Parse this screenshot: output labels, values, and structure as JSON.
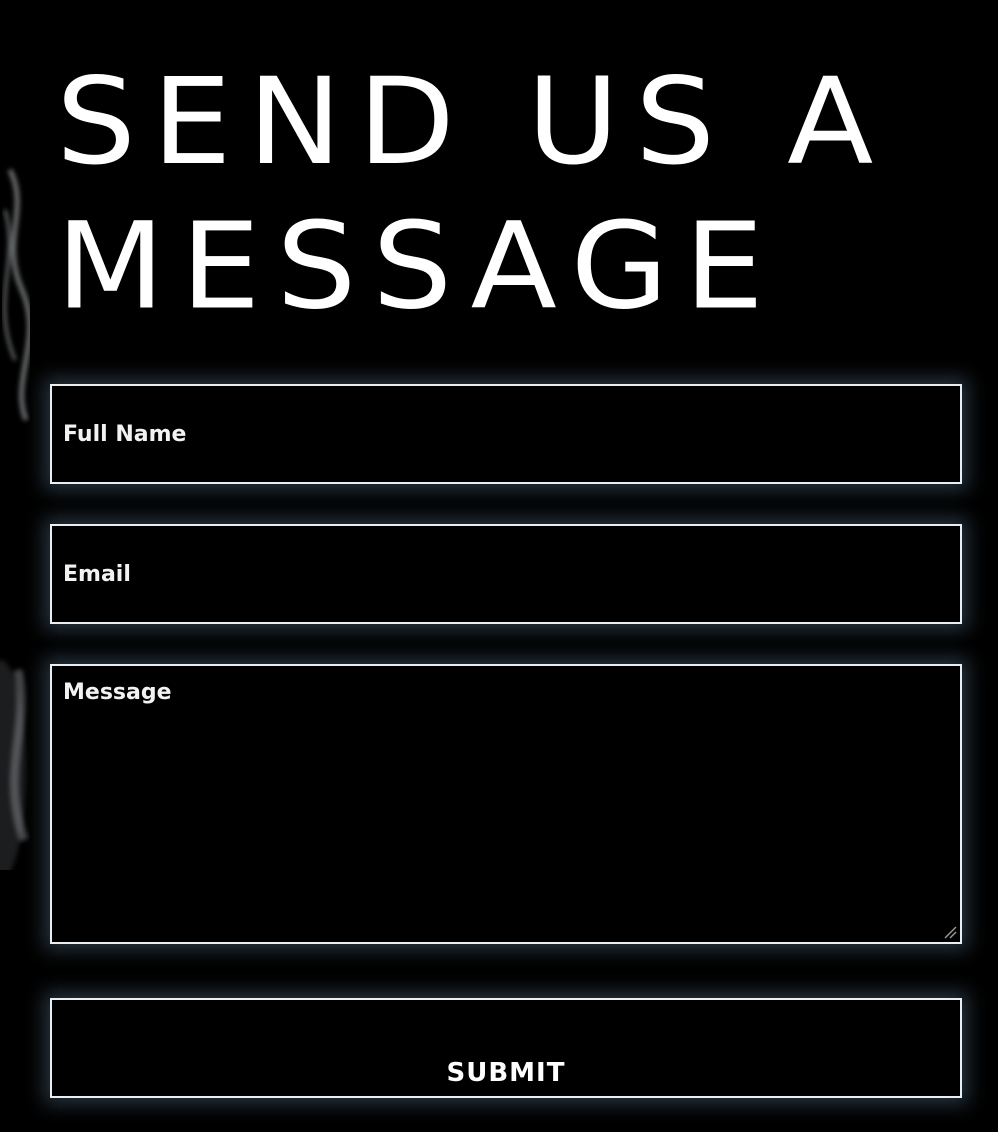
{
  "form": {
    "title": "SEND US A MESSAGE",
    "fields": {
      "full_name": {
        "placeholder": "Full Name",
        "value": ""
      },
      "email": {
        "placeholder": "Email",
        "value": ""
      },
      "message": {
        "placeholder": "Message",
        "value": ""
      }
    },
    "submit_label": "SUBMIT"
  },
  "colors": {
    "background": "#000000",
    "text": "#ffffff",
    "border": "#e9eef2",
    "glow": "#6e96b4"
  }
}
